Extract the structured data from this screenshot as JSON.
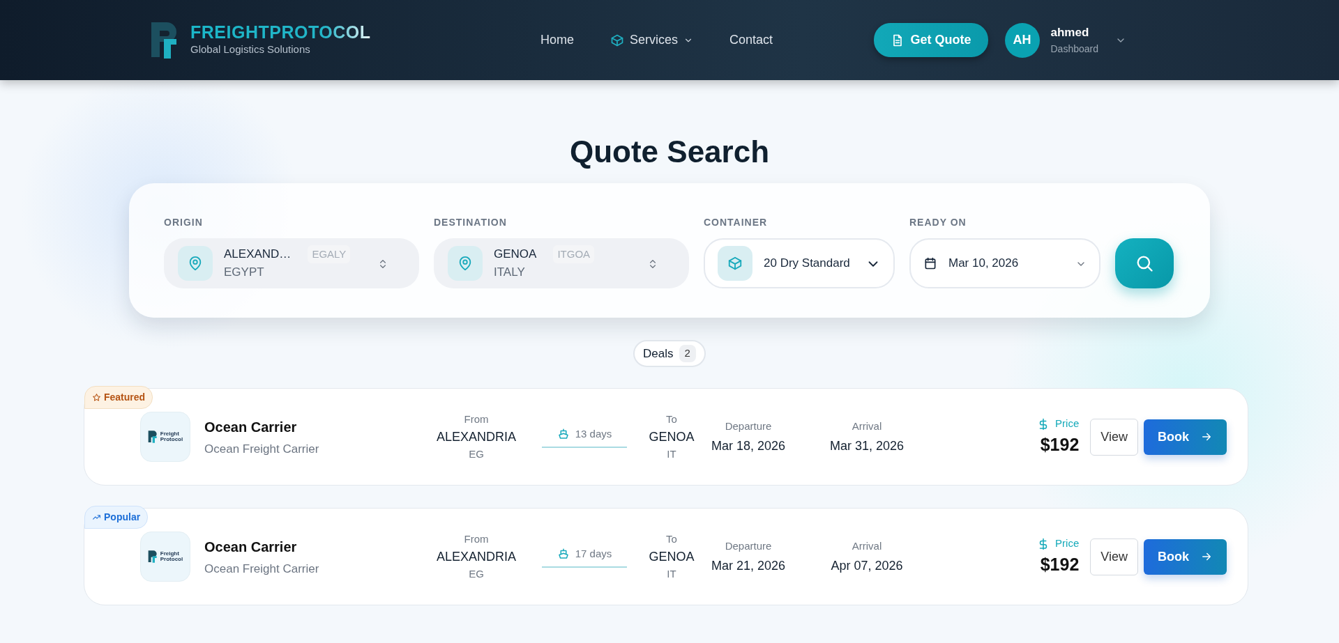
{
  "brand": {
    "name": "FREIGHTPROTOCOL",
    "tagline": "Global Logistics Solutions"
  },
  "nav": [
    {
      "label": "Home",
      "kind": "link"
    },
    {
      "label": "Services",
      "kind": "dropdown"
    },
    {
      "label": "Contact",
      "kind": "link"
    }
  ],
  "quote_button": "Get Quote",
  "user": {
    "initials": "AH",
    "name": "ahmed",
    "subtitle": "Dashboard"
  },
  "title": "Quote Search",
  "search": {
    "origin": {
      "label": "ORIGIN",
      "city": "ALEXAND…",
      "code": "EGALY",
      "country": "EGYPT"
    },
    "destination": {
      "label": "DESTINATION",
      "city": "GENOA",
      "code": "ITGOA",
      "country": "ITALY"
    },
    "container": {
      "label": "CONTAINER",
      "value": "20 Dry Standard"
    },
    "ready_on": {
      "label": "READY ON",
      "value": "Mar 10, 2026"
    }
  },
  "deals": {
    "label": "Deals",
    "count": "2"
  },
  "results": [
    {
      "badge": {
        "kind": "featured",
        "label": "Featured"
      },
      "logo_text": [
        "Freight",
        "Protocol"
      ],
      "name": "Ocean Carrier",
      "subtitle": "Ocean Freight Carrier",
      "from_label": "From",
      "from_city": "ALEXANDRIA",
      "from_country": "EG",
      "duration": "13 days",
      "to_label": "To",
      "to_city": "GENOA",
      "to_country": "IT",
      "departure_label": "Departure",
      "departure": "Mar 18, 2026",
      "arrival_label": "Arrival",
      "arrival": "Mar 31, 2026",
      "price_label": "Price",
      "price": "$192",
      "view": "View",
      "book": "Book"
    },
    {
      "badge": {
        "kind": "popular",
        "label": "Popular"
      },
      "logo_text": [
        "Freight",
        "Protocol"
      ],
      "name": "Ocean Carrier",
      "subtitle": "Ocean Freight Carrier",
      "from_label": "From",
      "from_city": "ALEXANDRIA",
      "from_country": "EG",
      "duration": "17 days",
      "to_label": "To",
      "to_city": "GENOA",
      "to_country": "IT",
      "departure_label": "Departure",
      "departure": "Mar 21, 2026",
      "arrival_label": "Arrival",
      "arrival": "Apr 07, 2026",
      "price_label": "Price",
      "price": "$192",
      "view": "View",
      "book": "Book"
    }
  ]
}
